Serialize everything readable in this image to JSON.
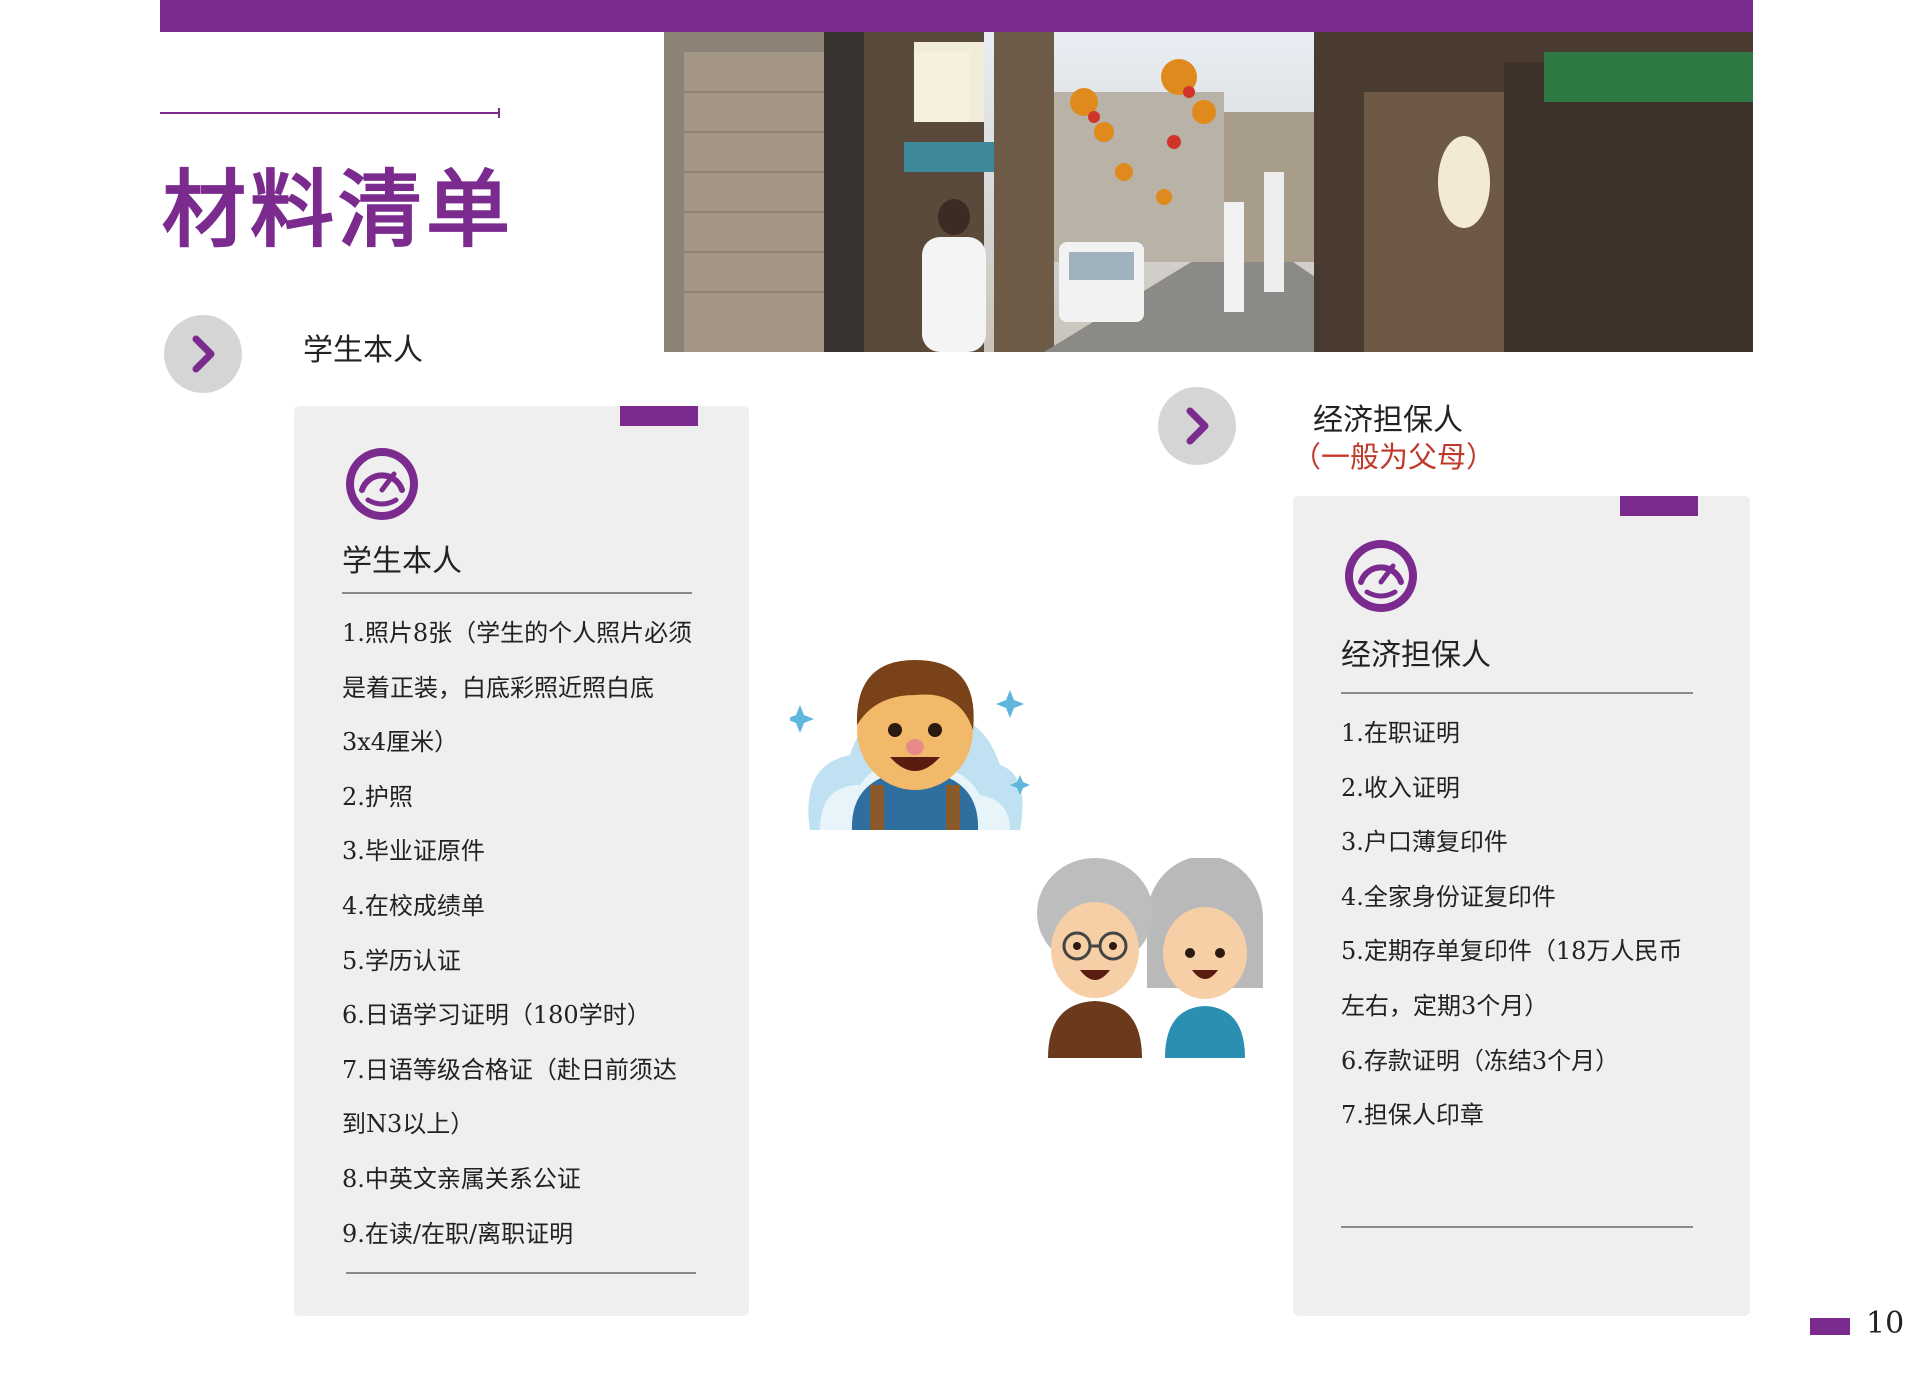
{
  "page_title": "材料清单",
  "page_number": "10",
  "sections": {
    "student_label": "学生本人",
    "guarantor_label": "经济担保人",
    "guarantor_sub": "（一般为父母）"
  },
  "student_card": {
    "heading": "学生本人",
    "lines": [
      "1.照片8张（学生的个人照片必须",
      "是着正装，白底彩照近照白底",
      "3x4厘米）",
      "2.护照",
      "3.毕业证原件",
      "4.在校成绩单",
      "5.学历认证",
      "6.日语学习证明（180学时）",
      "7.日语等级合格证（赴日前须达",
      "到N3以上）",
      "8.中英文亲属关系公证",
      "9.在读/在职/离职证明"
    ]
  },
  "guarantor_card": {
    "heading": "经济担保人",
    "lines": [
      "1.在职证明",
      "2.收入证明",
      "3.户口薄复印件",
      "4.全家身份证复印件",
      "5.定期存单复印件（18万人民币",
      "左右，定期3个月）",
      "6.存款证明（冻结3个月）",
      "7.担保人印章"
    ]
  },
  "colors": {
    "accent": "#7b2a8e",
    "note_red": "#c0392b",
    "card_bg": "#efefef"
  },
  "icons": [
    "chevron-right-icon",
    "speedometer-icon"
  ]
}
